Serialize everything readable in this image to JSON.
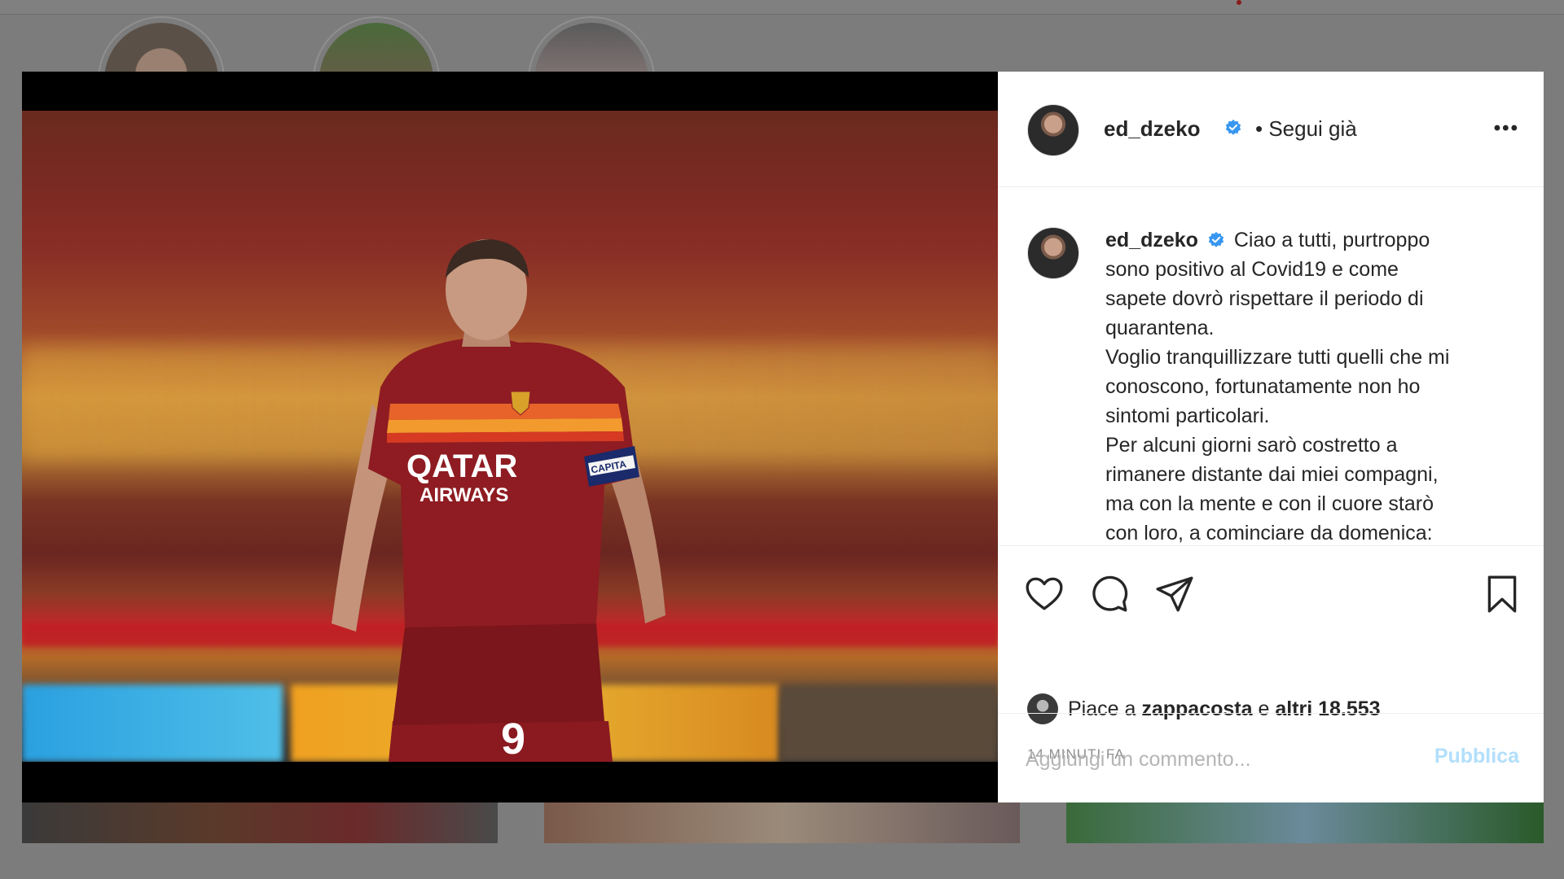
{
  "post": {
    "username": "ed_dzeko",
    "follow_status": "• Segui già",
    "more_label": "•••",
    "caption_lines": [
      "Ciao a tutti, purtroppo",
      "sono positivo al Covid19 e come",
      "sapete dovrò rispettare il periodo di",
      "quarantena.",
      "Voglio tranquillizzare tutti quelli che mi",
      "conoscono, fortunatamente non ho",
      "sintomi particolari.",
      "Per alcuni giorni sarò costretto a",
      "rimanere distante dai miei compagni,",
      "ma con la mente e con il cuore starò",
      "con loro, a cominciare da domenica:"
    ],
    "likes_prefix": "Piace a ",
    "likes_user": "zappacosta",
    "likes_middle": " e ",
    "likes_others": "altri 18.553",
    "time_ago": "14 MINUTI FA",
    "comment_placeholder": "Aggiungi un commento...",
    "publish_label": "Pubblica"
  },
  "photo": {
    "shirt_sponsor_line1": "QATAR",
    "shirt_sponsor_line2": "AIRWAYS",
    "armband_text": "CAPITA",
    "shirt_number": "9"
  },
  "colors": {
    "verified_blue": "#3897f0",
    "publish_disabled": "#b2dffc",
    "jersey_red": "#8e1c22",
    "overlay_gray": "#7c7c7c"
  },
  "icons": [
    "heart-icon",
    "comment-icon",
    "share-icon",
    "bookmark-icon",
    "verified-icon",
    "more-icon"
  ]
}
